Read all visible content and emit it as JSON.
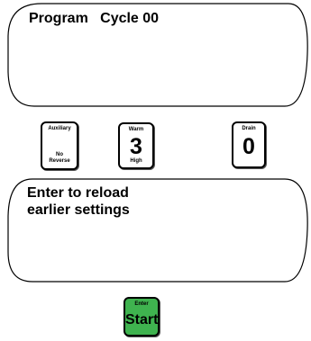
{
  "display_top": {
    "text": "Program   Cycle 00"
  },
  "display_bottom": {
    "line1": "Enter to reload",
    "line2": "earlier settings"
  },
  "keys": {
    "auxiliary": {
      "top_label": "Auxiliary",
      "bottom_label_1": "No",
      "bottom_label_2": "Reverse",
      "value": ""
    },
    "warm": {
      "top_label": "Warm",
      "value": "3",
      "bottom_label": "High"
    },
    "drain": {
      "top_label": "Drain",
      "value": "0"
    },
    "enter": {
      "top_label": "Enter",
      "value": "Start",
      "color": "#3fb34f"
    }
  }
}
